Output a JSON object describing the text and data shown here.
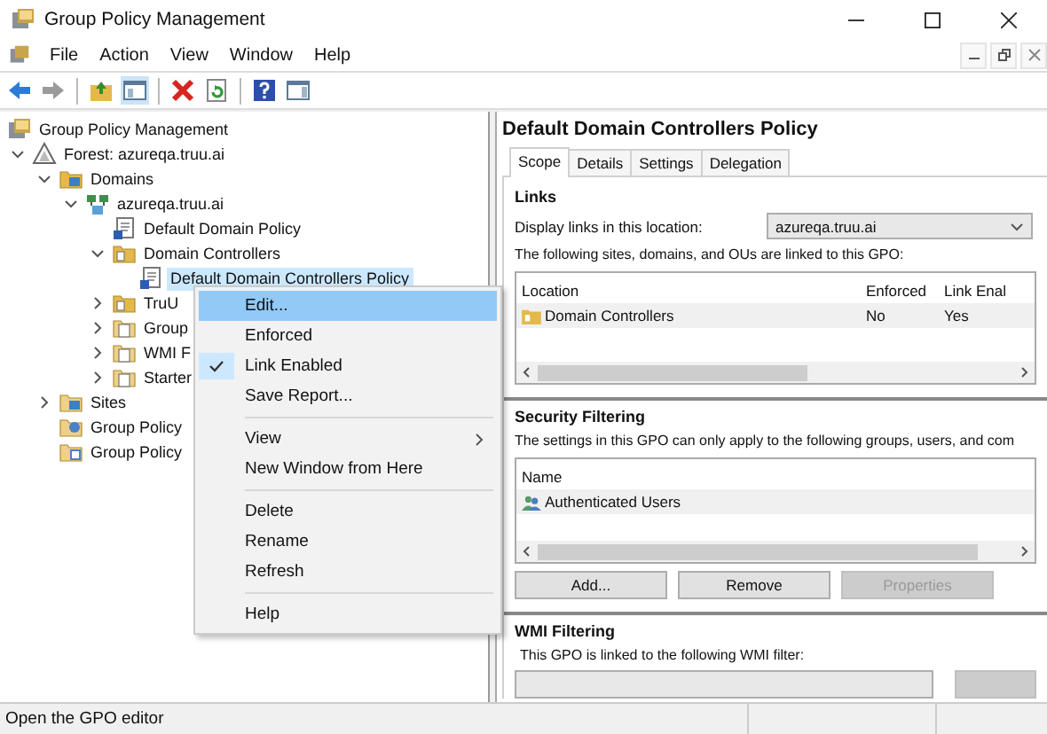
{
  "window": {
    "title": "Group Policy Management"
  },
  "menu_bar": [
    "File",
    "Action",
    "View",
    "Window",
    "Help"
  ],
  "toolbar": [
    {
      "kind": "back",
      "disabled": false
    },
    {
      "kind": "forward",
      "disabled": true
    },
    {
      "kind": "separator"
    },
    {
      "kind": "up"
    },
    {
      "kind": "tree"
    },
    {
      "kind": "separator"
    },
    {
      "kind": "delete"
    },
    {
      "kind": "refresh"
    },
    {
      "kind": "separator"
    },
    {
      "kind": "help"
    },
    {
      "kind": "pane"
    }
  ],
  "tree": [
    {
      "label": "Group Policy Management",
      "kind": "console",
      "selected": false,
      "children": [
        {
          "label": "Forest: azureqa.truu.ai",
          "kind": "forest",
          "selected": false,
          "expanded": true,
          "children": [
            {
              "label": "Domains",
              "kind": "domains",
              "selected": false,
              "expanded": true,
              "children": [
                {
                  "label": "azureqa.truu.ai",
                  "kind": "domain",
                  "selected": false,
                  "expanded": true,
                  "children": [
                    {
                      "label": "Default Domain Policy",
                      "kind": "gpo",
                      "selected": false
                    },
                    {
                      "label": "Domain Controllers",
                      "kind": "ou",
                      "selected": false,
                      "expanded": true,
                      "children": [
                        {
                          "label": "Default Domain Controllers Policy",
                          "kind": "gpo",
                          "selected": true
                        }
                      ]
                    },
                    {
                      "label": "TruU",
                      "kind": "ou",
                      "selected": false,
                      "expanded": false
                    },
                    {
                      "label": "Group",
                      "kind": "gpo-folder",
                      "selected": false,
                      "expanded": false
                    },
                    {
                      "label": "WMI F",
                      "kind": "wmi",
                      "selected": false,
                      "expanded": false
                    },
                    {
                      "label": "Starter",
                      "kind": "starter",
                      "selected": false,
                      "expanded": false
                    }
                  ]
                }
              ]
            },
            {
              "label": "Sites",
              "kind": "sites",
              "selected": false,
              "expanded": false
            },
            {
              "label": "Group Policy",
              "kind": "modeling",
              "selected": false
            },
            {
              "label": "Group Policy",
              "kind": "results",
              "selected": false
            }
          ]
        }
      ]
    }
  ],
  "context_menu": [
    {
      "kind": "item",
      "label": "Edit...",
      "selected": true,
      "checked": false,
      "submenu": false
    },
    {
      "kind": "item",
      "label": "Enforced",
      "selected": false,
      "checked": false,
      "submenu": false
    },
    {
      "kind": "item",
      "label": "Link Enabled",
      "selected": false,
      "checked": true,
      "submenu": false
    },
    {
      "kind": "item",
      "label": "Save Report...",
      "selected": false,
      "checked": false,
      "submenu": false
    },
    {
      "kind": "separator"
    },
    {
      "kind": "item",
      "label": "View",
      "selected": false,
      "checked": false,
      "submenu": true
    },
    {
      "kind": "item",
      "label": "New Window from Here",
      "selected": false,
      "checked": false,
      "submenu": false
    },
    {
      "kind": "separator"
    },
    {
      "kind": "item",
      "label": "Delete",
      "selected": false,
      "checked": false,
      "submenu": false
    },
    {
      "kind": "item",
      "label": "Rename",
      "selected": false,
      "checked": false,
      "submenu": false
    },
    {
      "kind": "item",
      "label": "Refresh",
      "selected": false,
      "checked": false,
      "submenu": false
    },
    {
      "kind": "separator"
    },
    {
      "kind": "item",
      "label": "Help",
      "selected": false,
      "checked": false,
      "submenu": false
    }
  ],
  "details": {
    "title": "Default Domain Controllers Policy",
    "tabs": [
      {
        "label": "Scope",
        "selected": true
      },
      {
        "label": "Details",
        "selected": false
      },
      {
        "label": "Settings",
        "selected": false
      },
      {
        "label": "Delegation",
        "selected": false
      }
    ],
    "links": {
      "heading": "Links",
      "location_label": "Display links in this location:",
      "location_value": "azureqa.truu.ai",
      "description": "The following sites, domains, and OUs are linked to this GPO:",
      "columns": [
        "Location",
        "Enforced",
        "Link Enal"
      ],
      "rows": [
        [
          "Domain Controllers",
          "No",
          "Yes"
        ]
      ]
    },
    "security_filtering": {
      "heading": "Security Filtering",
      "description": "The settings in this GPO can only apply to the following groups, users, and com",
      "columns": [
        "Name"
      ],
      "rows": [
        "Authenticated Users"
      ],
      "buttons": [
        {
          "label": "Add...",
          "disabled": false
        },
        {
          "label": "Remove",
          "disabled": false
        },
        {
          "label": "Properties",
          "disabled": true
        }
      ]
    },
    "wmi_filtering": {
      "heading": "WMI Filtering",
      "description": "This GPO is linked to the following WMI filter:"
    }
  },
  "status_bar": "Open the GPO editor"
}
